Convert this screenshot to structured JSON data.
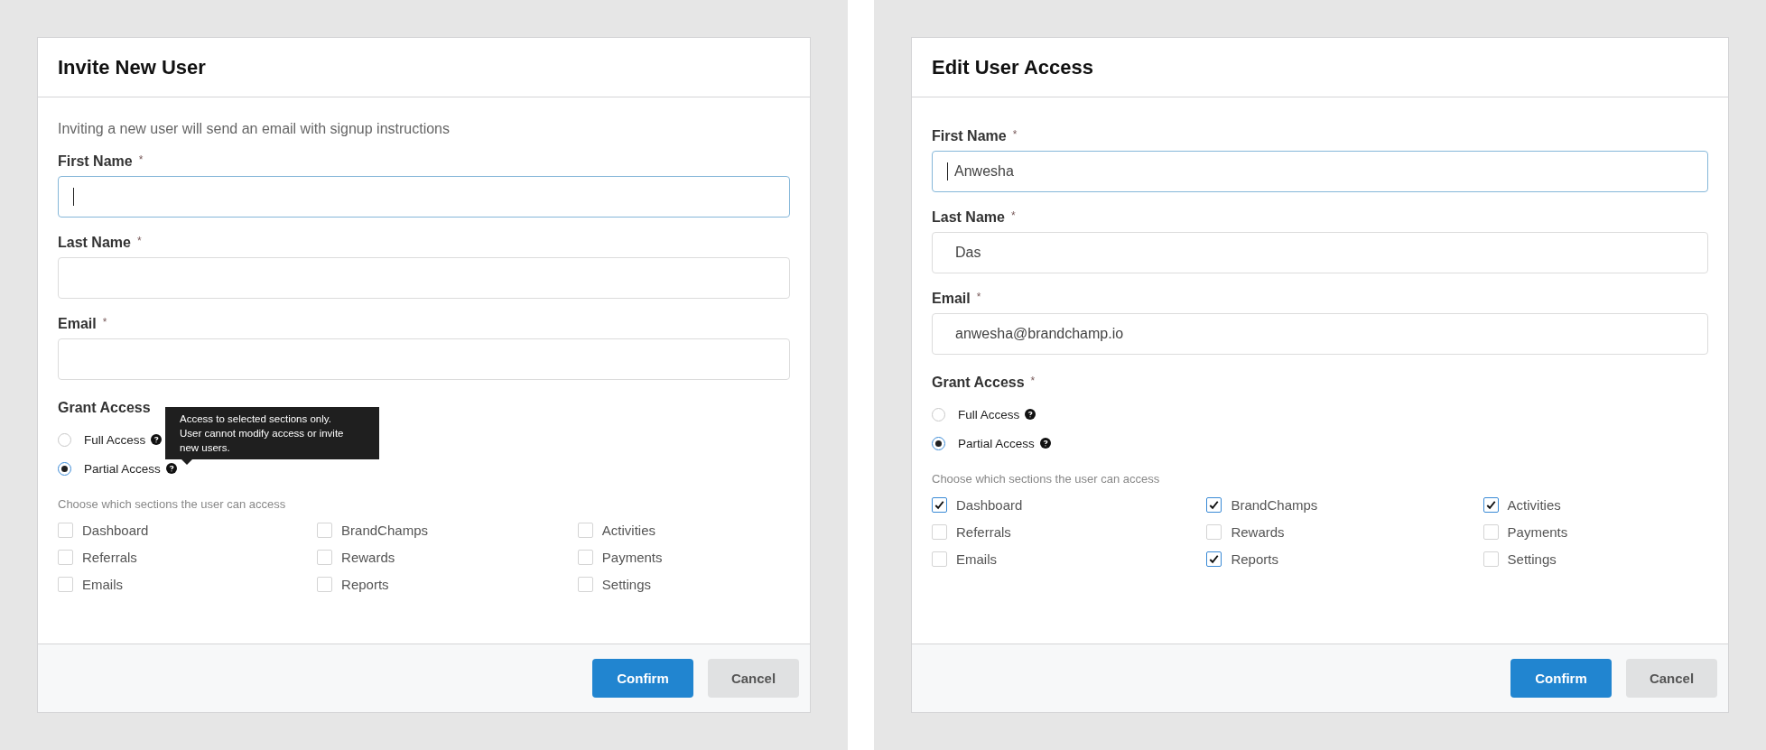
{
  "dialogs": [
    {
      "title": "Invite New User",
      "subtitle": "Inviting a new user will send an email with signup instructions",
      "fields": [
        {
          "label": "First Name",
          "required_mark": "*",
          "focused": true
        },
        {
          "label": "Last Name",
          "required_mark": "*",
          "focused": false
        },
        {
          "label": "Email",
          "required_mark": "*",
          "focused": false
        }
      ],
      "grant_access": {
        "label": "Grant Access",
        "options": [
          {
            "label": "Full Access",
            "selected": false
          },
          {
            "label": "Partial Access",
            "selected": true,
            "tooltip": "Access to selected sections only. User cannot modify access or invite new users."
          }
        ]
      },
      "sections_hint": "Choose which sections the user can access",
      "sections": [
        {
          "label": "Dashboard",
          "checked": false
        },
        {
          "label": "BrandChamps",
          "checked": false
        },
        {
          "label": "Activities",
          "checked": false
        },
        {
          "label": "Referrals",
          "checked": false
        },
        {
          "label": "Rewards",
          "checked": false
        },
        {
          "label": "Payments",
          "checked": false
        },
        {
          "label": "Emails",
          "checked": false
        },
        {
          "label": "Reports",
          "checked": false
        },
        {
          "label": "Settings",
          "checked": false
        }
      ],
      "buttons": [
        {
          "label": "Confirm",
          "kind": "primary"
        },
        {
          "label": "Cancel",
          "kind": "secondary"
        }
      ]
    },
    {
      "title": "Edit User Access",
      "fields": [
        {
          "label": "First Name",
          "required_mark": "*",
          "value": "Anwesha",
          "focused": true
        },
        {
          "label": "Last Name",
          "required_mark": "*",
          "value": "Das",
          "focused": false
        },
        {
          "label": "Email",
          "required_mark": "*",
          "value": "anwesha@brandchamp.io",
          "focused": false
        }
      ],
      "grant_access": {
        "label": "Grant Access",
        "required_mark": "*",
        "options": [
          {
            "label": "Full Access",
            "selected": false
          },
          {
            "label": "Partial Access",
            "selected": true
          }
        ]
      },
      "sections_hint": "Choose which sections the user can access",
      "sections": [
        {
          "label": "Dashboard",
          "checked": true
        },
        {
          "label": "BrandChamps",
          "checked": true
        },
        {
          "label": "Activities",
          "checked": true
        },
        {
          "label": "Referrals",
          "checked": false
        },
        {
          "label": "Rewards",
          "checked": false
        },
        {
          "label": "Payments",
          "checked": false
        },
        {
          "label": "Emails",
          "checked": false
        },
        {
          "label": "Reports",
          "checked": true
        },
        {
          "label": "Settings",
          "checked": false
        }
      ],
      "buttons": [
        {
          "label": "Confirm",
          "kind": "primary"
        },
        {
          "label": "Cancel",
          "kind": "secondary"
        }
      ]
    }
  ]
}
